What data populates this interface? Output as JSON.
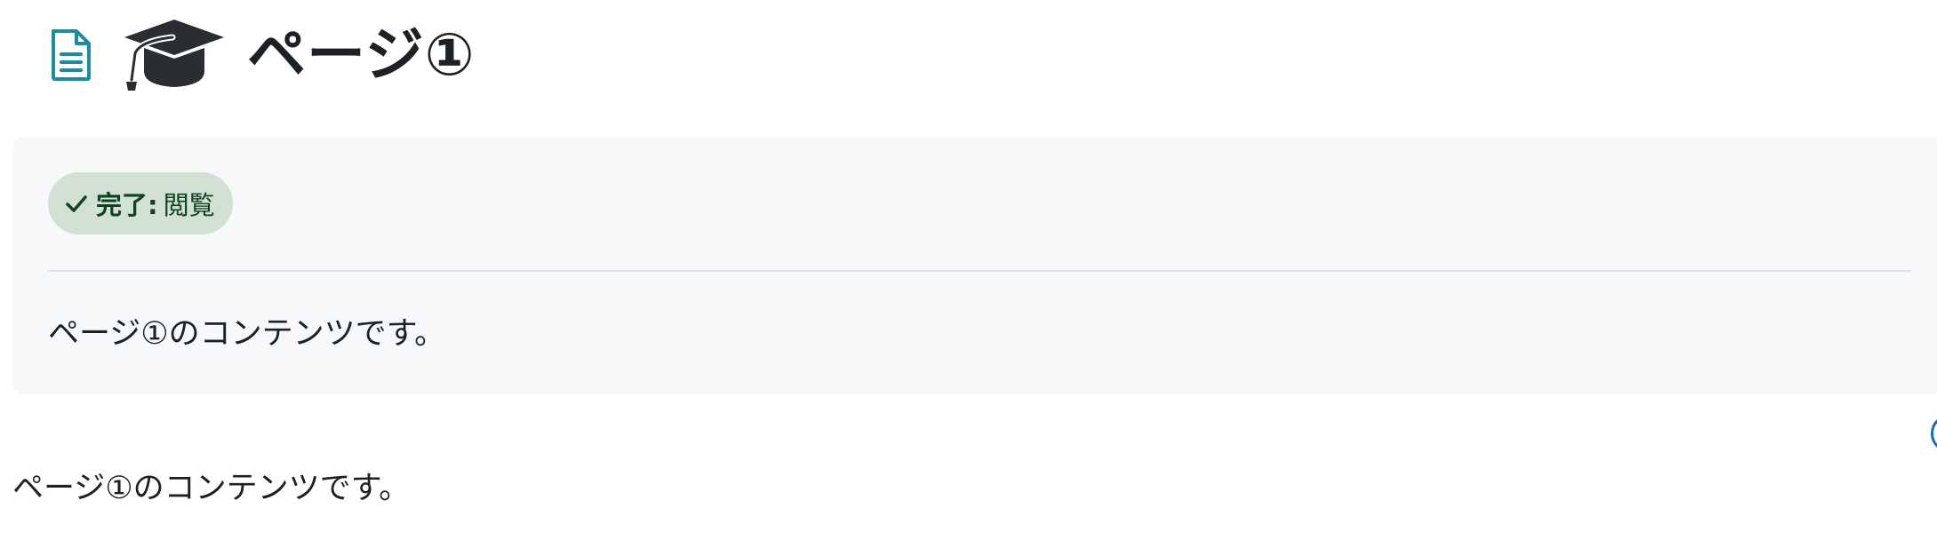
{
  "header": {
    "title": "ページ①",
    "doc_icon": "document-icon",
    "activity_icon": "graduation-cap-icon"
  },
  "completion": {
    "status_label": "完了:",
    "status_value": "閲覧",
    "icon": "check-icon",
    "colors": {
      "badge_bg": "#d2e1d4",
      "badge_text": "#10421f"
    }
  },
  "panel": {
    "text": "ページ①のコンテンツです。"
  },
  "main": {
    "text": "ページ①のコンテンツです。"
  },
  "colors": {
    "doc_icon": "#1b8ba0",
    "title_text": "#1d2125",
    "panel_bg": "#f7f8f9"
  }
}
